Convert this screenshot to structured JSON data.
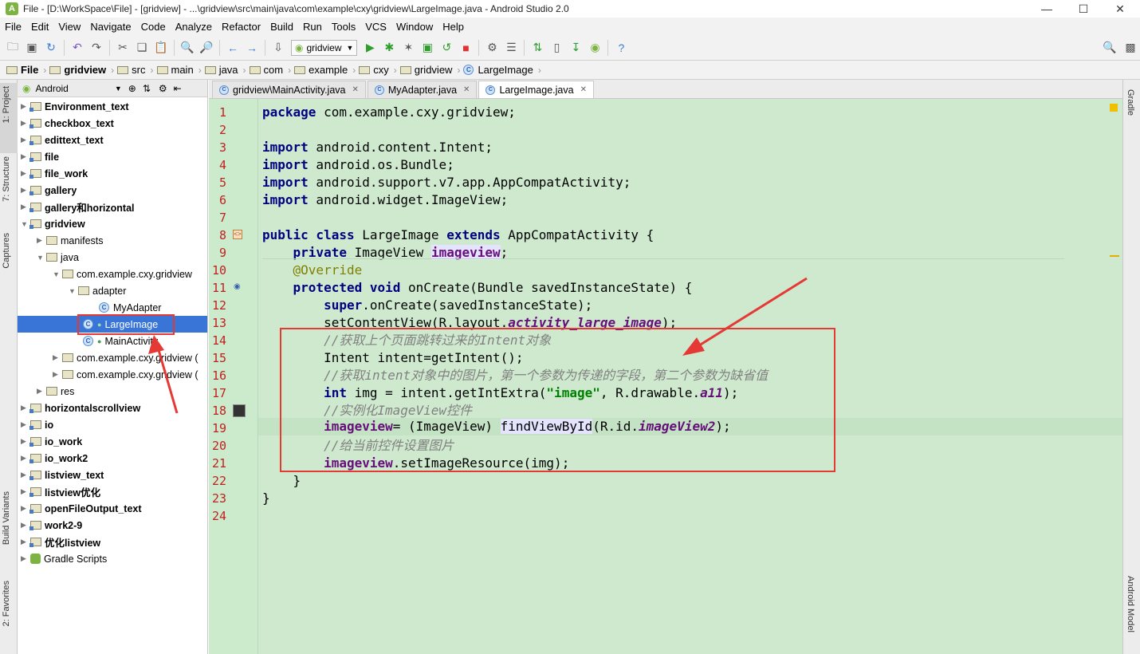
{
  "window": {
    "title": "File - [D:\\WorkSpace\\File] - [gridview] - ...\\gridview\\src\\main\\java\\com\\example\\cxy\\gridview\\LargeImage.java - Android Studio 2.0"
  },
  "menu": [
    "File",
    "Edit",
    "View",
    "Navigate",
    "Code",
    "Analyze",
    "Refactor",
    "Build",
    "Run",
    "Tools",
    "VCS",
    "Window",
    "Help"
  ],
  "toolbar": {
    "run_config": "gridview"
  },
  "breadcrumb": [
    "File",
    "gridview",
    "src",
    "main",
    "java",
    "com",
    "example",
    "cxy",
    "gridview",
    "LargeImage"
  ],
  "side_tabs": {
    "left": [
      "1: Project",
      "7: Structure",
      "Captures",
      "Build Variants",
      "2: Favorites"
    ],
    "right": [
      "Gradle",
      "Android Model"
    ]
  },
  "project_panel": {
    "view_mode": "Android",
    "tree": [
      {
        "label": "Environment_text",
        "bold": true
      },
      {
        "label": "checkbox_text",
        "bold": true
      },
      {
        "label": "edittext_text",
        "bold": true
      },
      {
        "label": "file",
        "bold": true
      },
      {
        "label": "file_work",
        "bold": true
      },
      {
        "label": "gallery",
        "bold": true
      },
      {
        "label": "gallery和horizontal",
        "bold": true
      },
      {
        "label": "gridview",
        "bold": true
      },
      {
        "label": "manifests",
        "bold": false
      },
      {
        "label": "java",
        "bold": false
      },
      {
        "label": "com.example.cxy.gridview",
        "bold": false
      },
      {
        "label": "adapter",
        "bold": false
      },
      {
        "label": "MyAdapter",
        "bold": false
      },
      {
        "label": "LargeImage",
        "bold": false
      },
      {
        "label": "MainActivity",
        "bold": false
      },
      {
        "label": "com.example.cxy.gridview (",
        "bold": false
      },
      {
        "label": "com.example.cxy.gridview (",
        "bold": false
      },
      {
        "label": "res",
        "bold": false
      },
      {
        "label": "horizontalscrollview",
        "bold": true
      },
      {
        "label": "io",
        "bold": true
      },
      {
        "label": "io_work",
        "bold": true
      },
      {
        "label": "io_work2",
        "bold": true
      },
      {
        "label": "listview_text",
        "bold": true
      },
      {
        "label": "listview优化",
        "bold": true
      },
      {
        "label": "openFileOutput_text",
        "bold": true
      },
      {
        "label": "work2-9",
        "bold": true
      },
      {
        "label": "优化listview",
        "bold": true
      },
      {
        "label": "Gradle Scripts",
        "bold": false
      }
    ]
  },
  "editor_tabs": [
    {
      "label": "gridview\\MainActivity.java",
      "active": false
    },
    {
      "label": "MyAdapter.java",
      "active": false
    },
    {
      "label": "LargeImage.java",
      "active": true
    }
  ],
  "code_lines": [
    "1",
    "2",
    "3",
    "4",
    "5",
    "6",
    "7",
    "8",
    "9",
    "10",
    "11",
    "12",
    "13",
    "14",
    "15",
    "16",
    "17",
    "18",
    "19",
    "20",
    "21",
    "22",
    "23",
    "24"
  ],
  "code": {
    "l1a": "package",
    "l1b": " com.example.cxy.gridview;",
    "import_kw": "import",
    "l3": " android.content.Intent;",
    "l4": " android.os.Bundle;",
    "l5": " android.support.v7.app.AppCompatActivity;",
    "l6": " android.widget.ImageView;",
    "l8a": "public class",
    "l8b": " LargeImage ",
    "l8c": "extends",
    "l8d": " AppCompatActivity {",
    "l9a": "    private",
    "l9b": " ImageView ",
    "l9c": "imageview",
    "l9d": ";",
    "l10": "    @Override",
    "l11a": "    protected void",
    "l11b": " onCreate(Bundle savedInstanceState) {",
    "l12a": "        super",
    "l12b": ".onCreate(savedInstanceState);",
    "l13a": "        setContentView(R.layout.",
    "l13b": "activity_large_image",
    "l13c": ");",
    "l14": "        //获取上个页面跳转过来的Intent对象",
    "l15": "        Intent intent=getIntent();",
    "l16": "        //获取intent对象中的图片，第一个参数为传递的字段，第二个参数为缺省值",
    "l17a": "        int",
    "l17b": " img = intent.getIntExtra(",
    "l17c": "\"image\"",
    "l17d": ", R.drawable.",
    "l17e": "a11",
    "l17f": ");",
    "l18": "        //实例化ImageView控件",
    "l19a": "        imageview",
    "l19b": "= (ImageView) ",
    "l19c": "findViewById",
    "l19d": "(R.id.",
    "l19e": "imageView2",
    "l19f": ");",
    "l20": "        //给当前控件设置图片",
    "l21a": "        imageview",
    "l21b": ".setImageResource(img);",
    "l22": "    }",
    "l23": "}"
  },
  "colors": {
    "editor_bg": "#cfe9cf",
    "line_number": "#c02020",
    "keyword": "#000080",
    "annotation_red": "#e53935",
    "selection": "#3875d7"
  }
}
